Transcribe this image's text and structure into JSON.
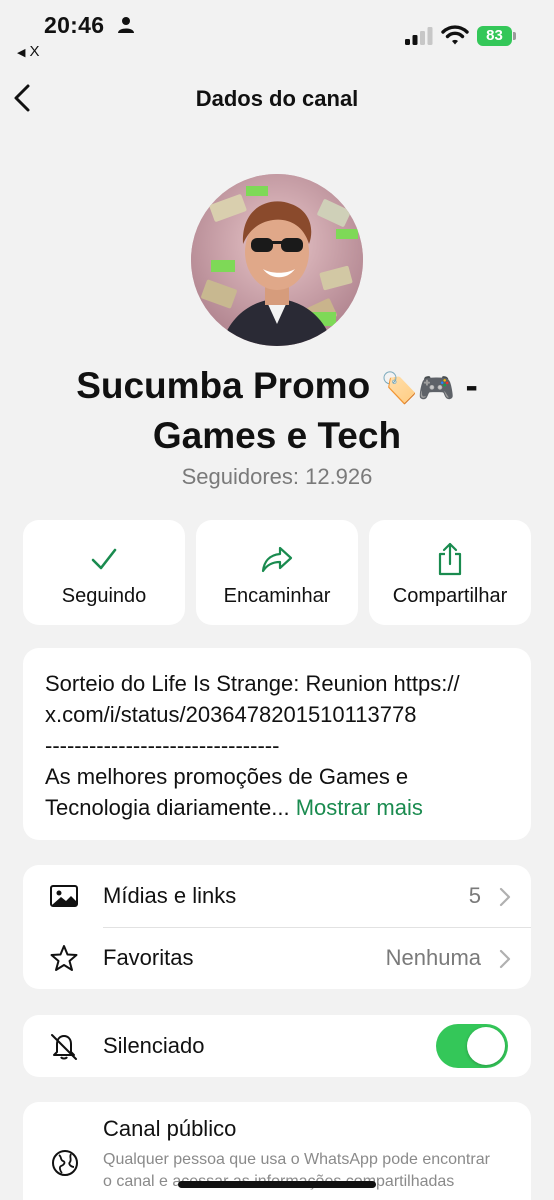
{
  "status_bar": {
    "time": "20:46",
    "back_app": "X",
    "battery": "83",
    "battery_color": "#34c759"
  },
  "nav": {
    "title": "Dados do canal"
  },
  "channel": {
    "name_part1": "Sucumba Promo",
    "name_emoji": "🏷️🎮",
    "name_part2": "-",
    "name_line2": "Games e Tech",
    "followers": "Seguidores: 12.926"
  },
  "actions": [
    {
      "label": "Seguindo",
      "icon": "checkmark-icon"
    },
    {
      "label": "Encaminhar",
      "icon": "forward-icon"
    },
    {
      "label": "Compartilhar",
      "icon": "share-icon"
    }
  ],
  "description": {
    "line1": "Sorteio do Life Is Strange: Reunion https://",
    "line2": "x.com/i/status/2036478201510113778",
    "line3": "--------------------------------",
    "line4": "As melhores promoções de Games e",
    "line5": "Tecnologia diariamente...",
    "more": "Mostrar mais"
  },
  "list": {
    "media_label": "Mídias e links",
    "media_value": "5",
    "favorites_label": "Favoritas",
    "favorites_value": "Nenhuma"
  },
  "mute": {
    "label": "Silenciado",
    "enabled": true
  },
  "public": {
    "title": "Canal público",
    "description": "Qualquer pessoa que usa o WhatsApp pode encontrar o canal e acessar as informações compartilhadas"
  },
  "colors": {
    "accent_green": "#1a8b4f",
    "toggle_green": "#34c759",
    "background": "#f2f2f2"
  }
}
